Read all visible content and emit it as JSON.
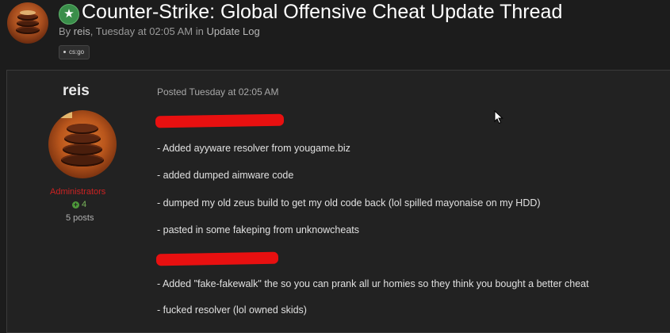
{
  "thread": {
    "title": "Counter-Strike: Global Offensive Cheat Update Thread",
    "byline_prefix": "By",
    "author": "reis",
    "date": "Tuesday at 02:05 AM",
    "in_word": "in",
    "forum": "Update Log",
    "tag": "cs:go",
    "star_icon": "★"
  },
  "post": {
    "author": "reis",
    "role": "Administrators",
    "reputation": "4",
    "posts_count": "5 posts",
    "posted": "Posted Tuesday at 02:05 AM",
    "lines": [
      "- Added ayyware resolver from yougame.biz",
      "- added dumped aimware code",
      "- dumped my old zeus build to get my old code back (lol spilled mayonaise on my HDD)",
      "- pasted in some fakeping from unknowcheats",
      "- Added \"fake-fakewalk\" the so you can prank all ur homies so they think you bought a better cheat",
      "- fucked resolver (lol owned skids)"
    ]
  },
  "colors": {
    "background": "#1c1c1c",
    "post_background": "#222222",
    "role_red": "#cc2222",
    "reputation_green": "#7ab65c",
    "redaction_red": "#e81010",
    "featured_star_green": "#3a8e4a"
  }
}
